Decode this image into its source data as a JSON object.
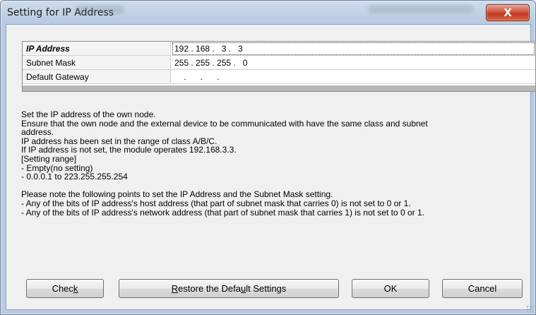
{
  "window": {
    "title": "Setting for IP Address",
    "close_glyph": "X"
  },
  "grid": {
    "rows": [
      {
        "label": "IP Address",
        "value": "192 . 168 .   3 .   3"
      },
      {
        "label": "Subnet Mask",
        "value": "255 . 255 . 255 .   0"
      },
      {
        "label": "Default Gateway",
        "value": "    .      .      ."
      }
    ]
  },
  "description": [
    "Set the IP address of the own node.",
    "Ensure that the own node and the external device to be communicated with have the same class and subnet",
    "address.",
    "IP address has been set in the range of class A/B/C.",
    "If IP address is not set, the module operates 192.168.3.3.",
    "[Setting range]",
    "- Empty(no setting)",
    "- 0.0.0.1 to 223.255.255.254",
    "",
    "Please note the following points to set the IP Address and the Subnet Mask setting.",
    "- Any of the bits of IP address's host address (that part of subnet mask that carries 0) is not set to 0 or 1.",
    "- Any of the bits of IP address's network address (that part of subnet mask that carries 1) is not set to 0 or 1."
  ],
  "buttons": {
    "check": {
      "before": "Chec",
      "mnemonic": "k",
      "after": ""
    },
    "restore": {
      "before": "",
      "mnemonic": "R",
      "middle": "estore the Defa",
      "mnemonic2": "u",
      "after": "lt Settings"
    },
    "ok": "OK",
    "cancel": "Cancel"
  }
}
